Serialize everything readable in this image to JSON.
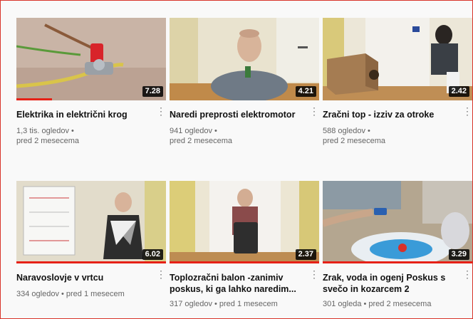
{
  "videos": [
    {
      "title": "Elektrika in električni krog",
      "duration": "7.28",
      "views": "1,3 tis. ogledov •",
      "age": "pred 2 mesecema",
      "progress": 0.24
    },
    {
      "title": "Naredi preprosti elektromotor",
      "duration": "4.21",
      "views": "941 ogledov •",
      "age": "pred 2 mesecema",
      "progress": 0
    },
    {
      "title": "Zračni top - izziv za otroke",
      "duration": "2.42",
      "views": "588 ogledov •",
      "age": "pred 2 mesecema",
      "progress": 0
    },
    {
      "title": "Naravoslovje v vrtcu",
      "duration": "6.02",
      "meta": "334 ogledov • pred 1 mesecem",
      "progress": 1.0
    },
    {
      "title": "Toplozračni balon -zanimiv poskus, ki ga lahko naredim...",
      "duration": "2.37",
      "meta": "317 ogledov • pred 1 mesecem",
      "progress": 1.0
    },
    {
      "title": "Zrak, voda in ogenj Poskus s svečo in kozarcem 2",
      "duration": "3.29",
      "meta": "301 ogleda • pred 2 mesecema",
      "progress": 1.0
    }
  ],
  "icons": {
    "menu": "more-vert-icon"
  },
  "colors": {
    "progress": "#e62117",
    "border": "#d9342b"
  }
}
